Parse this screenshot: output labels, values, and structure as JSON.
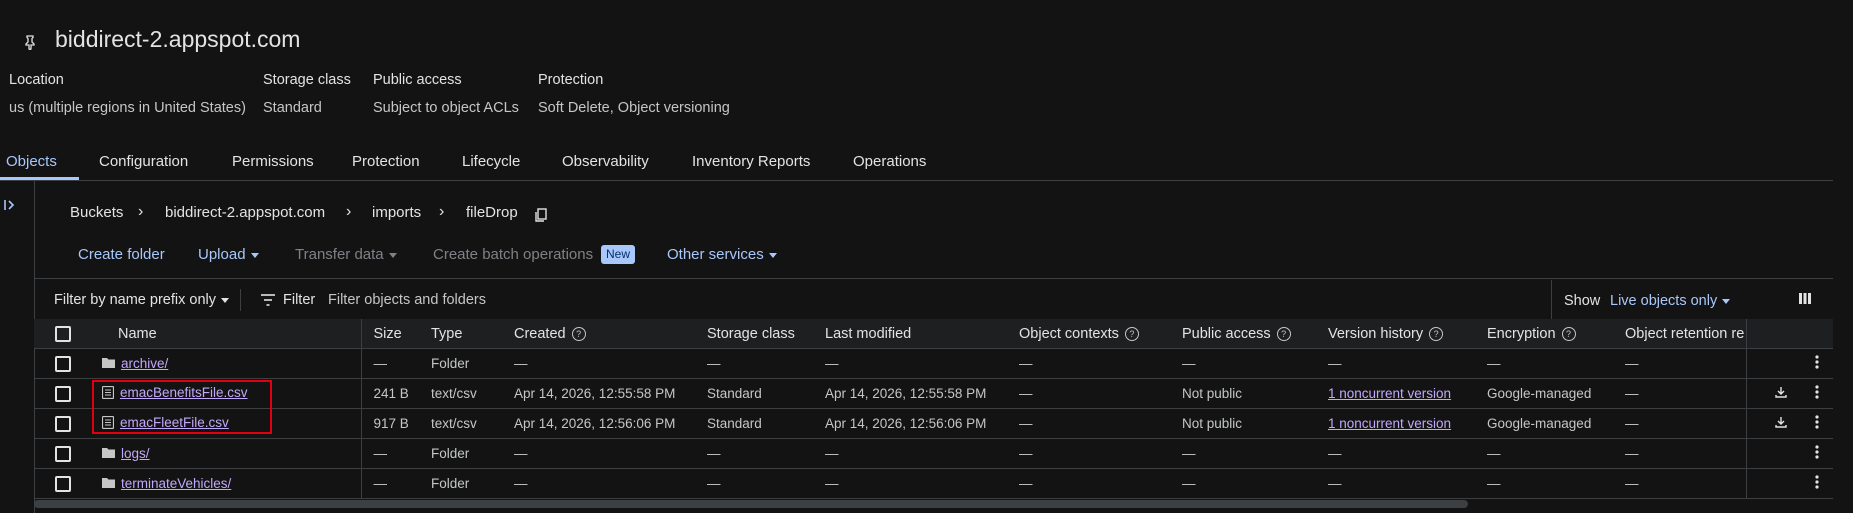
{
  "bucket": {
    "title": "biddirect-2.appspot.com",
    "meta": [
      {
        "label": "Location",
        "value": "us (multiple regions in United States)"
      },
      {
        "label": "Storage class",
        "value": "Standard"
      },
      {
        "label": "Public access",
        "value": "Subject to object ACLs"
      },
      {
        "label": "Protection",
        "value": "Soft Delete, Object versioning"
      }
    ]
  },
  "tabs": [
    "Objects",
    "Configuration",
    "Permissions",
    "Protection",
    "Lifecycle",
    "Observability",
    "Inventory Reports",
    "Operations"
  ],
  "active_tab": "Objects",
  "breadcrumb": [
    "Buckets",
    "biddirect-2.appspot.com",
    "imports",
    "fileDrop"
  ],
  "toolbar": {
    "create_folder": "Create folder",
    "upload": "Upload",
    "transfer_data": "Transfer data",
    "create_batch": "Create batch operations",
    "new_badge": "New",
    "other_services": "Other services"
  },
  "filter": {
    "prefix_label": "Filter by name prefix only",
    "filter_label": "Filter",
    "placeholder": "Filter objects and folders",
    "show_label": "Show",
    "show_value": "Live objects only"
  },
  "columns": [
    "Name",
    "Size",
    "Type",
    "Created",
    "Storage class",
    "Last modified",
    "Object contexts",
    "Public access",
    "Version history",
    "Encryption",
    "Object retention re"
  ],
  "rows": [
    {
      "name": "archive/",
      "kind": "folder",
      "size": "—",
      "type": "Folder",
      "created": "—",
      "storage_class": "—",
      "last_modified": "—",
      "object_contexts": "—",
      "public_access": "—",
      "version_history": "—",
      "encryption": "—",
      "retention": "—"
    },
    {
      "name": "emacBenefitsFile.csv",
      "kind": "file",
      "size": "241 B",
      "type": "text/csv",
      "created": "Apr 14, 2026, 12:55:58 PM",
      "storage_class": "Standard",
      "last_modified": "Apr 14, 2026, 12:55:58 PM",
      "object_contexts": "—",
      "public_access": "Not public",
      "version_history": "1 noncurrent version",
      "encryption": "Google-managed",
      "retention": "—"
    },
    {
      "name": "emacFleetFile.csv",
      "kind": "file",
      "size": "917 B",
      "type": "text/csv",
      "created": "Apr 14, 2026, 12:56:06 PM",
      "storage_class": "Standard",
      "last_modified": "Apr 14, 2026, 12:56:06 PM",
      "object_contexts": "—",
      "public_access": "Not public",
      "version_history": "1 noncurrent version",
      "encryption": "Google-managed",
      "retention": "—"
    },
    {
      "name": "logs/",
      "kind": "folder",
      "size": "—",
      "type": "Folder",
      "created": "—",
      "storage_class": "—",
      "last_modified": "—",
      "object_contexts": "—",
      "public_access": "—",
      "version_history": "—",
      "encryption": "—",
      "retention": "—"
    },
    {
      "name": "terminateVehicles/",
      "kind": "folder",
      "size": "—",
      "type": "Folder",
      "created": "—",
      "storage_class": "—",
      "last_modified": "—",
      "object_contexts": "—",
      "public_access": "—",
      "version_history": "—",
      "encryption": "—",
      "retention": "—"
    }
  ],
  "colors": {
    "background": "#131314",
    "accent": "#a8c7fa",
    "link": "#c2a8fa",
    "highlight_box": "#e0000f"
  }
}
